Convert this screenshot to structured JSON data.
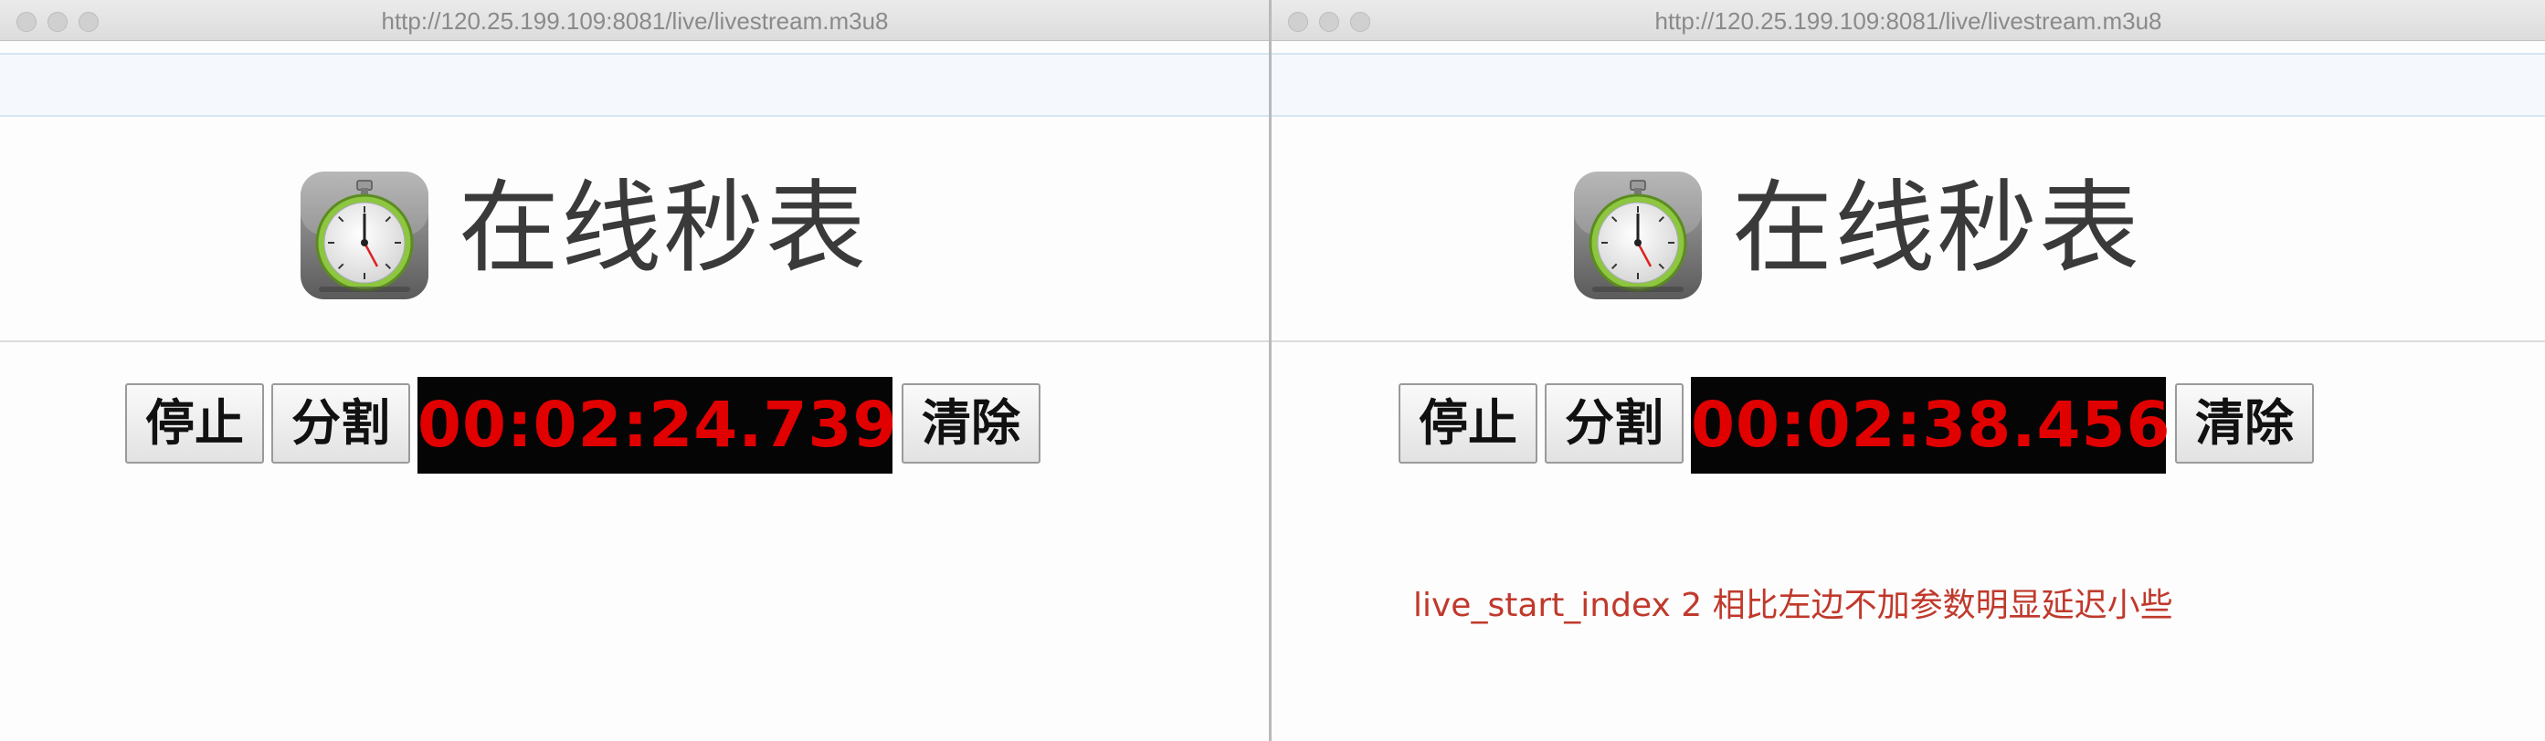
{
  "left_window": {
    "url": "http://120.25.199.109:8081/live/livestream.m3u8",
    "heading": "在线秒表",
    "buttons": {
      "stop": "停止",
      "split": "分割",
      "clear": "清除"
    },
    "timer": "00:02:24.739"
  },
  "right_window": {
    "url": "http://120.25.199.109:8081/live/livestream.m3u8",
    "heading": "在线秒表",
    "buttons": {
      "stop": "停止",
      "split": "分割",
      "clear": "清除"
    },
    "timer": "00:02:38.456",
    "note": "live_start_index 2 相比左边不加参数明显延迟小些"
  },
  "icons": {
    "window_controls": "traffic-light-icons",
    "logo": "stopwatch-icon"
  },
  "colors": {
    "timer_digits": "#e10000",
    "timer_background": "#050505",
    "note_text": "#c0392b"
  }
}
